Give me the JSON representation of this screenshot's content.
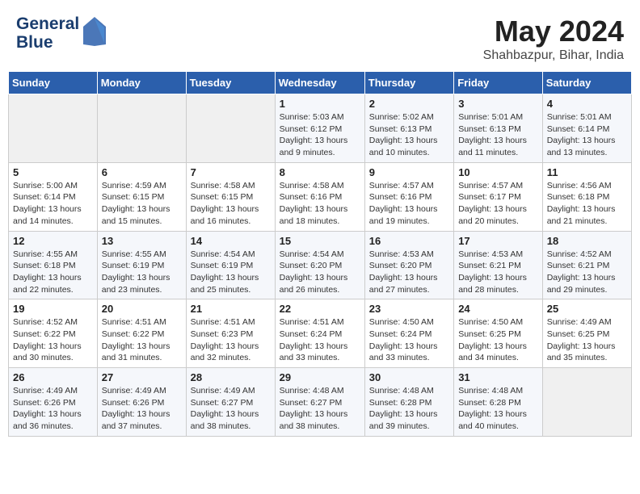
{
  "header": {
    "logo_line1": "General",
    "logo_line2": "Blue",
    "month": "May 2024",
    "location": "Shahbazpur, Bihar, India"
  },
  "weekdays": [
    "Sunday",
    "Monday",
    "Tuesday",
    "Wednesday",
    "Thursday",
    "Friday",
    "Saturday"
  ],
  "weeks": [
    [
      {
        "day": "",
        "info": ""
      },
      {
        "day": "",
        "info": ""
      },
      {
        "day": "",
        "info": ""
      },
      {
        "day": "1",
        "info": "Sunrise: 5:03 AM\nSunset: 6:12 PM\nDaylight: 13 hours\nand 9 minutes."
      },
      {
        "day": "2",
        "info": "Sunrise: 5:02 AM\nSunset: 6:13 PM\nDaylight: 13 hours\nand 10 minutes."
      },
      {
        "day": "3",
        "info": "Sunrise: 5:01 AM\nSunset: 6:13 PM\nDaylight: 13 hours\nand 11 minutes."
      },
      {
        "day": "4",
        "info": "Sunrise: 5:01 AM\nSunset: 6:14 PM\nDaylight: 13 hours\nand 13 minutes."
      }
    ],
    [
      {
        "day": "5",
        "info": "Sunrise: 5:00 AM\nSunset: 6:14 PM\nDaylight: 13 hours\nand 14 minutes."
      },
      {
        "day": "6",
        "info": "Sunrise: 4:59 AM\nSunset: 6:15 PM\nDaylight: 13 hours\nand 15 minutes."
      },
      {
        "day": "7",
        "info": "Sunrise: 4:58 AM\nSunset: 6:15 PM\nDaylight: 13 hours\nand 16 minutes."
      },
      {
        "day": "8",
        "info": "Sunrise: 4:58 AM\nSunset: 6:16 PM\nDaylight: 13 hours\nand 18 minutes."
      },
      {
        "day": "9",
        "info": "Sunrise: 4:57 AM\nSunset: 6:16 PM\nDaylight: 13 hours\nand 19 minutes."
      },
      {
        "day": "10",
        "info": "Sunrise: 4:57 AM\nSunset: 6:17 PM\nDaylight: 13 hours\nand 20 minutes."
      },
      {
        "day": "11",
        "info": "Sunrise: 4:56 AM\nSunset: 6:18 PM\nDaylight: 13 hours\nand 21 minutes."
      }
    ],
    [
      {
        "day": "12",
        "info": "Sunrise: 4:55 AM\nSunset: 6:18 PM\nDaylight: 13 hours\nand 22 minutes."
      },
      {
        "day": "13",
        "info": "Sunrise: 4:55 AM\nSunset: 6:19 PM\nDaylight: 13 hours\nand 23 minutes."
      },
      {
        "day": "14",
        "info": "Sunrise: 4:54 AM\nSunset: 6:19 PM\nDaylight: 13 hours\nand 25 minutes."
      },
      {
        "day": "15",
        "info": "Sunrise: 4:54 AM\nSunset: 6:20 PM\nDaylight: 13 hours\nand 26 minutes."
      },
      {
        "day": "16",
        "info": "Sunrise: 4:53 AM\nSunset: 6:20 PM\nDaylight: 13 hours\nand 27 minutes."
      },
      {
        "day": "17",
        "info": "Sunrise: 4:53 AM\nSunset: 6:21 PM\nDaylight: 13 hours\nand 28 minutes."
      },
      {
        "day": "18",
        "info": "Sunrise: 4:52 AM\nSunset: 6:21 PM\nDaylight: 13 hours\nand 29 minutes."
      }
    ],
    [
      {
        "day": "19",
        "info": "Sunrise: 4:52 AM\nSunset: 6:22 PM\nDaylight: 13 hours\nand 30 minutes."
      },
      {
        "day": "20",
        "info": "Sunrise: 4:51 AM\nSunset: 6:22 PM\nDaylight: 13 hours\nand 31 minutes."
      },
      {
        "day": "21",
        "info": "Sunrise: 4:51 AM\nSunset: 6:23 PM\nDaylight: 13 hours\nand 32 minutes."
      },
      {
        "day": "22",
        "info": "Sunrise: 4:51 AM\nSunset: 6:24 PM\nDaylight: 13 hours\nand 33 minutes."
      },
      {
        "day": "23",
        "info": "Sunrise: 4:50 AM\nSunset: 6:24 PM\nDaylight: 13 hours\nand 33 minutes."
      },
      {
        "day": "24",
        "info": "Sunrise: 4:50 AM\nSunset: 6:25 PM\nDaylight: 13 hours\nand 34 minutes."
      },
      {
        "day": "25",
        "info": "Sunrise: 4:49 AM\nSunset: 6:25 PM\nDaylight: 13 hours\nand 35 minutes."
      }
    ],
    [
      {
        "day": "26",
        "info": "Sunrise: 4:49 AM\nSunset: 6:26 PM\nDaylight: 13 hours\nand 36 minutes."
      },
      {
        "day": "27",
        "info": "Sunrise: 4:49 AM\nSunset: 6:26 PM\nDaylight: 13 hours\nand 37 minutes."
      },
      {
        "day": "28",
        "info": "Sunrise: 4:49 AM\nSunset: 6:27 PM\nDaylight: 13 hours\nand 38 minutes."
      },
      {
        "day": "29",
        "info": "Sunrise: 4:48 AM\nSunset: 6:27 PM\nDaylight: 13 hours\nand 38 minutes."
      },
      {
        "day": "30",
        "info": "Sunrise: 4:48 AM\nSunset: 6:28 PM\nDaylight: 13 hours\nand 39 minutes."
      },
      {
        "day": "31",
        "info": "Sunrise: 4:48 AM\nSunset: 6:28 PM\nDaylight: 13 hours\nand 40 minutes."
      },
      {
        "day": "",
        "info": ""
      }
    ]
  ]
}
